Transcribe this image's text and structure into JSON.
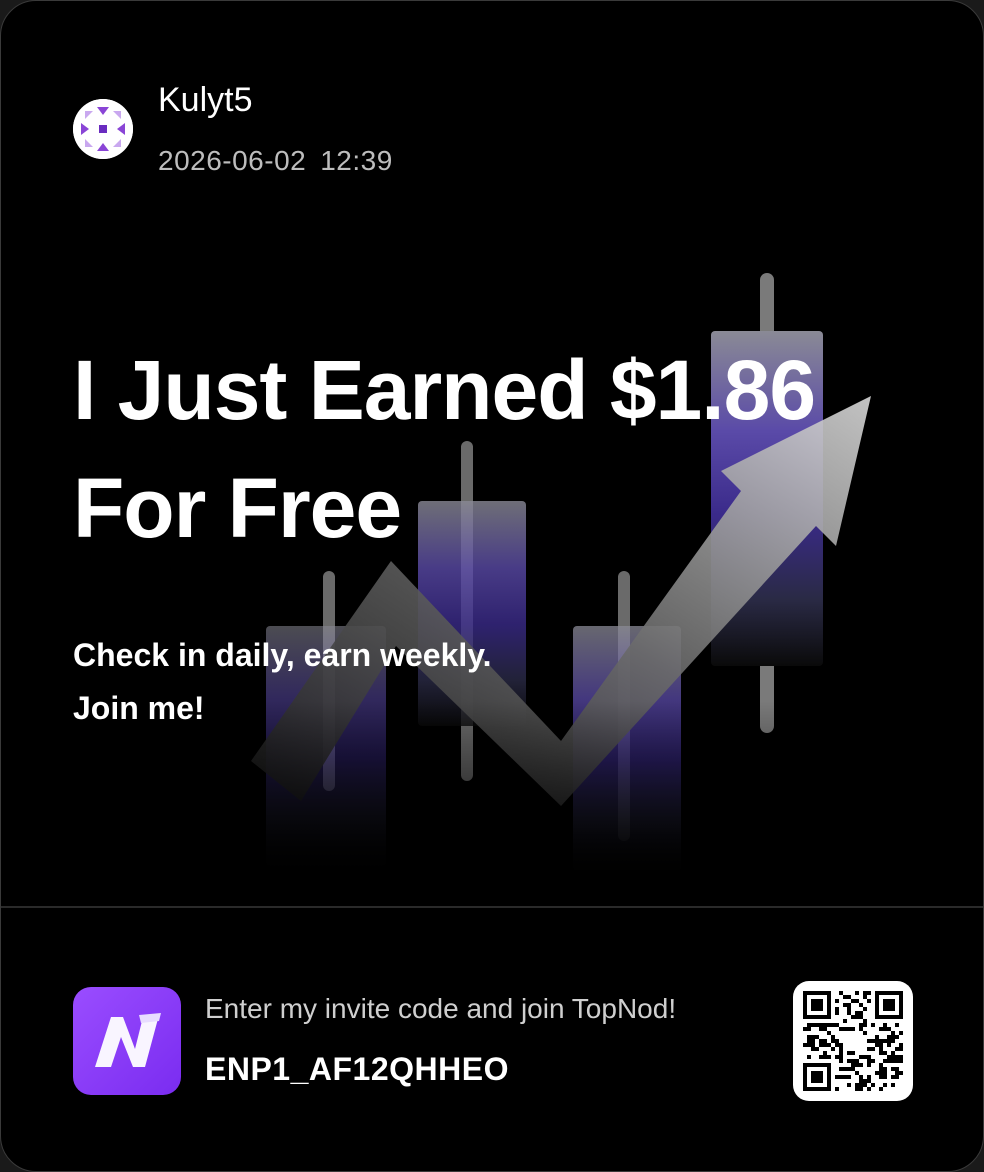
{
  "user": {
    "name": "Kulyt5",
    "date": "2026-06-02",
    "time": "12:39"
  },
  "headline": {
    "line1": "I Just Earned $1.86",
    "line2": "For Free"
  },
  "subtext": {
    "line1": "Check in daily, earn weekly.",
    "line2": "Join me!"
  },
  "invite": {
    "label": "Enter my invite code and join TopNod!",
    "code": "ENP1_AF12QHHEO"
  },
  "icons": {
    "avatar": "identicon-avatar",
    "app": "topnod-logo",
    "qr": "qr-code"
  },
  "colors": {
    "background": "#000000",
    "accent": "#8b3dff",
    "text": "#ffffff",
    "muted": "#bdbdbd"
  }
}
